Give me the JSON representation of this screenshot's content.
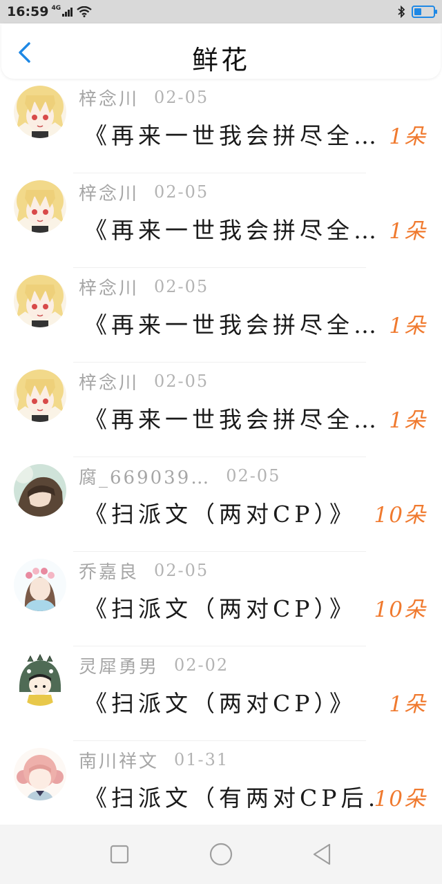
{
  "status_bar": {
    "time": "16:59",
    "network": "4G"
  },
  "header": {
    "title": "鲜花"
  },
  "records": [
    {
      "user": "梓念川",
      "date": "02-05",
      "message": "《再来一世我会拼尽全…",
      "count": "1朵",
      "avatar": "blonde-girl"
    },
    {
      "user": "梓念川",
      "date": "02-05",
      "message": "《再来一世我会拼尽全…",
      "count": "1朵",
      "avatar": "blonde-girl"
    },
    {
      "user": "梓念川",
      "date": "02-05",
      "message": "《再来一世我会拼尽全…",
      "count": "1朵",
      "avatar": "blonde-girl"
    },
    {
      "user": "梓念川",
      "date": "02-05",
      "message": "《再来一世我会拼尽全…",
      "count": "1朵",
      "avatar": "blonde-girl"
    },
    {
      "user": "腐_669039…",
      "date": "02-05",
      "message": "《扫派文（两对CP）》",
      "count": "10朵",
      "avatar": "brown-hair-boy"
    },
    {
      "user": "乔嘉良",
      "date": "02-05",
      "message": "《扫派文（两对CP）》",
      "count": "10朵",
      "avatar": "flower-crown-girl"
    },
    {
      "user": "灵犀勇男",
      "date": "02-02",
      "message": "《扫派文（两对CP）》",
      "count": "1朵",
      "avatar": "dinosaur-hood-girl"
    },
    {
      "user": "南川祥文",
      "date": "01-31",
      "message": "《扫派文（有两对CP后…",
      "count": "10朵",
      "avatar": "pink-hair-girl"
    }
  ],
  "colors": {
    "accent": "#1e88e5",
    "count": "#f07a2f",
    "meta": "#a6a6a6"
  },
  "nav": {
    "icons": [
      "square-recents-icon",
      "circle-home-icon",
      "triangle-back-icon"
    ]
  }
}
